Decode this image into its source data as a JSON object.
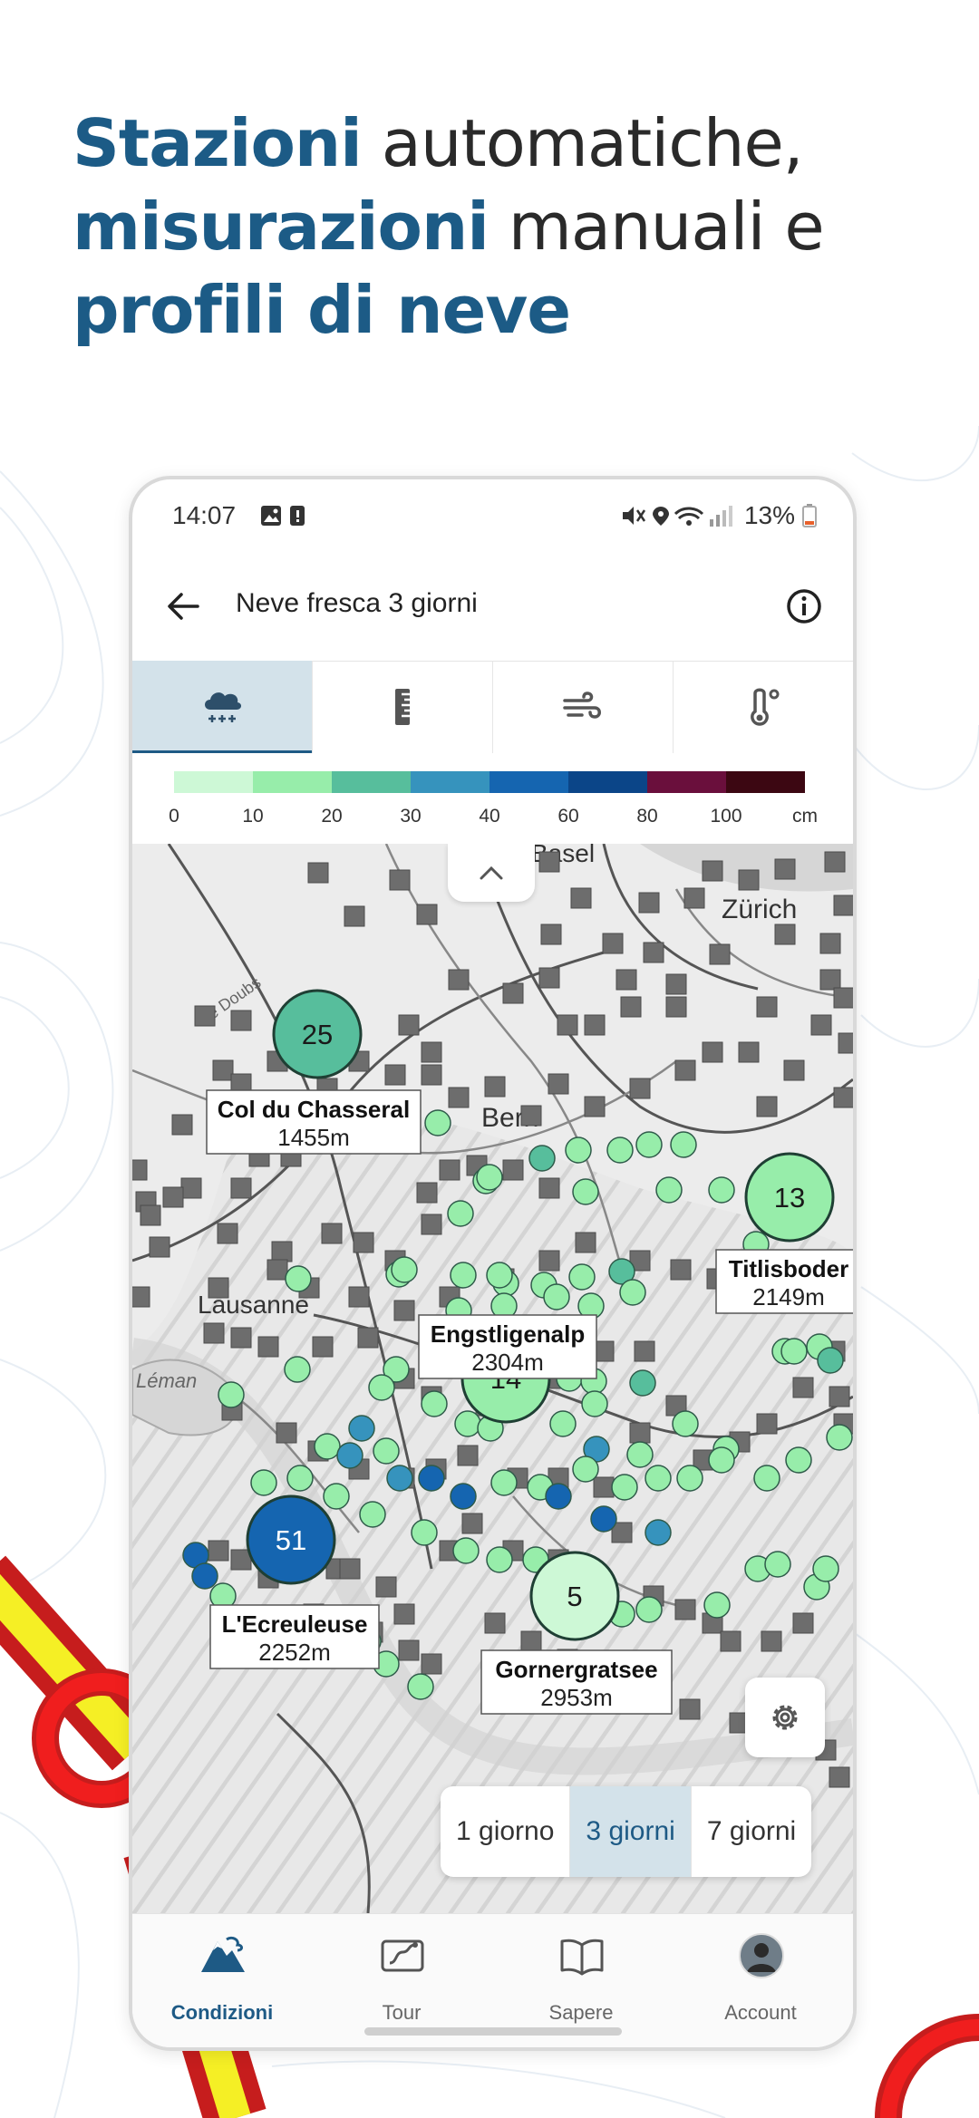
{
  "headline": {
    "bold1": "Stazioni",
    "text1": " automatiche,",
    "bold2": "misurazioni",
    "text2": " manuali e",
    "bold3": "profili di neve"
  },
  "status_bar": {
    "time": "14:07",
    "battery": "13%"
  },
  "app_bar": {
    "title": "Neve fresca 3 giorni"
  },
  "tabs": [
    {
      "icon": "snowfall-icon",
      "active": true
    },
    {
      "icon": "snow-depth-ruler-icon",
      "active": false
    },
    {
      "icon": "wind-icon",
      "active": false
    },
    {
      "icon": "thermometer-icon",
      "active": false
    }
  ],
  "legend": {
    "colors": [
      "#cdf8d6",
      "#97edaa",
      "#57be9c",
      "#3693bd",
      "#1565b0",
      "#0b4588",
      "#6a0f3c",
      "#3c0712"
    ],
    "ticks": [
      "0",
      "10",
      "20",
      "30",
      "40",
      "60",
      "80",
      "100",
      "cm"
    ]
  },
  "map": {
    "place_labels": [
      "Zürich",
      "Bern",
      "Lausanne",
      "Le Doubs",
      "Léman",
      "Basel"
    ],
    "clusters": [
      {
        "count": "25",
        "color": "#57be9c"
      },
      {
        "count": "13",
        "color": "#97edaa"
      },
      {
        "count": "14",
        "color": "#97edaa"
      },
      {
        "count": "51",
        "color": "#1565b0"
      },
      {
        "count": "5",
        "color": "#cdf8d6"
      }
    ],
    "stations": [
      {
        "name": "Col du Chasseral",
        "elevation": "1455m"
      },
      {
        "name": "Titlisboder",
        "elevation": "2149m"
      },
      {
        "name": "Engstligenalp",
        "elevation": "2304m"
      },
      {
        "name": "L'Ecreuleuse",
        "elevation": "2252m"
      },
      {
        "name": "Gornergratsee",
        "elevation": "2953m"
      }
    ]
  },
  "period_selector": {
    "options": [
      "1 giorno",
      "3 giorni",
      "7 giorni"
    ],
    "selected": "3 giorni"
  },
  "nav": [
    {
      "label": "Condizioni",
      "icon": "mountain-icon",
      "active": true
    },
    {
      "label": "Tour",
      "icon": "route-icon",
      "active": false
    },
    {
      "label": "Sapere",
      "icon": "book-icon",
      "active": false
    },
    {
      "label": "Account",
      "icon": "avatar",
      "active": false
    }
  ]
}
